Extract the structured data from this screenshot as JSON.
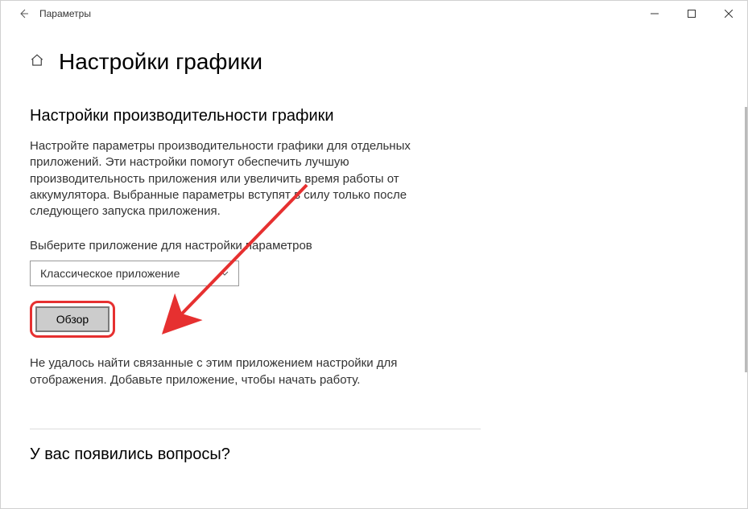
{
  "titlebar": {
    "title": "Параметры"
  },
  "header": {
    "page_title": "Настройки графики"
  },
  "main": {
    "section_title": "Настройки производительности графики",
    "description": "Настройте параметры производительности графики для отдельных приложений. Эти настройки помогут обеспечить лучшую производительность приложения или увеличить время работы от аккумулятора. Выбранные параметры вступят в силу только после следующего запуска приложения.",
    "select_label": "Выберите приложение для настройки параметров",
    "dropdown_selected": "Классическое приложение",
    "browse_label": "Обзор",
    "notfound_text": "Не удалось найти связанные с этим приложением настройки для отображения. Добавьте приложение, чтобы начать работу."
  },
  "help": {
    "title": "У вас появились вопросы?"
  }
}
